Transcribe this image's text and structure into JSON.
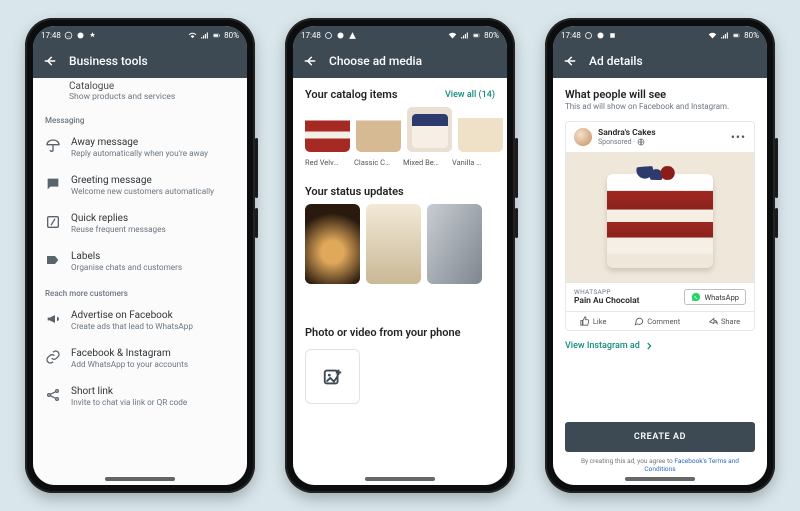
{
  "statusbar": {
    "time": "17:48",
    "battery": "80%"
  },
  "phone1": {
    "title": "Business tools",
    "cut": {
      "t1": "Catalogue",
      "t2": "Show products and services"
    },
    "sec_messaging": "Messaging",
    "items_msg": [
      {
        "t1": "Away message",
        "t2": "Reply automatically when you're away"
      },
      {
        "t1": "Greeting message",
        "t2": "Welcome new customers automatically"
      },
      {
        "t1": "Quick replies",
        "t2": "Reuse frequent messages"
      },
      {
        "t1": "Labels",
        "t2": "Organise chats and customers"
      }
    ],
    "sec_reach": "Reach more customers",
    "items_reach": [
      {
        "t1": "Advertise on Facebook",
        "t2": "Create ads that lead to WhatsApp"
      },
      {
        "t1": "Facebook & Instagram",
        "t2": "Add WhatsApp to your accounts"
      },
      {
        "t1": "Short link",
        "t2": "Invite to chat via link or QR code"
      }
    ]
  },
  "phone2": {
    "title": "Choose ad media",
    "catalog_h": "Your catalog items",
    "catalog_link": "View all (14)",
    "catalog_items": [
      "Red Velv…",
      "Classic C…",
      "Mixed Be…",
      "Vanilla …"
    ],
    "status_h": "Your status updates",
    "upload_h": "Photo or video from your phone"
  },
  "phone3": {
    "title": "Ad details",
    "h": "What people will see",
    "sub": "This ad will show on Facebook and Instagram.",
    "page_name": "Sandra's Cakes",
    "sponsored": "Sponsored · ",
    "cta_kicker": "WHATSAPP",
    "cta_label": "Pain Au Chocolat",
    "whatsapp_btn": "WhatsApp",
    "like": "Like",
    "comment": "Comment",
    "share": "Share",
    "view_ig": "View Instagram ad",
    "create": "CREATE AD",
    "terms_a": "By creating this ad, you agree to ",
    "terms_b": "Facebook's Terms and Conditions"
  }
}
